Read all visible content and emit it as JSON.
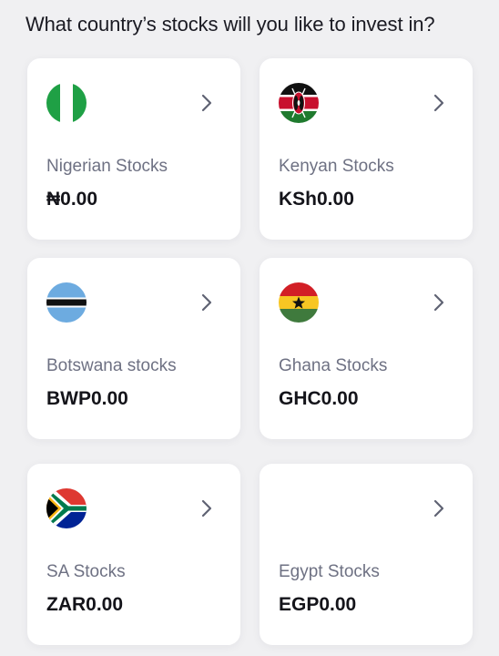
{
  "header": {
    "title": "What country’s stocks will you like to invest in?"
  },
  "cards": [
    {
      "name": "Nigerian Stocks",
      "amount": "₦0.00",
      "flag_icon": "nigeria-flag-icon"
    },
    {
      "name": "Kenyan Stocks",
      "amount": "KSh0.00",
      "flag_icon": "kenya-flag-icon"
    },
    {
      "name": "Botswana stocks",
      "amount": "BWP0.00",
      "flag_icon": "botswana-flag-icon"
    },
    {
      "name": "Ghana Stocks",
      "amount": "GHC0.00",
      "flag_icon": "ghana-flag-icon"
    },
    {
      "name": "SA Stocks",
      "amount": "ZAR0.00",
      "flag_icon": "south-africa-flag-icon"
    },
    {
      "name": "Egypt Stocks",
      "amount": "EGP0.00",
      "flag_icon": ""
    }
  ],
  "colors": {
    "background": "#f0f0f2",
    "card": "#ffffff",
    "label": "#6e7183",
    "amount": "#14141a",
    "chevron": "#5f6273"
  }
}
